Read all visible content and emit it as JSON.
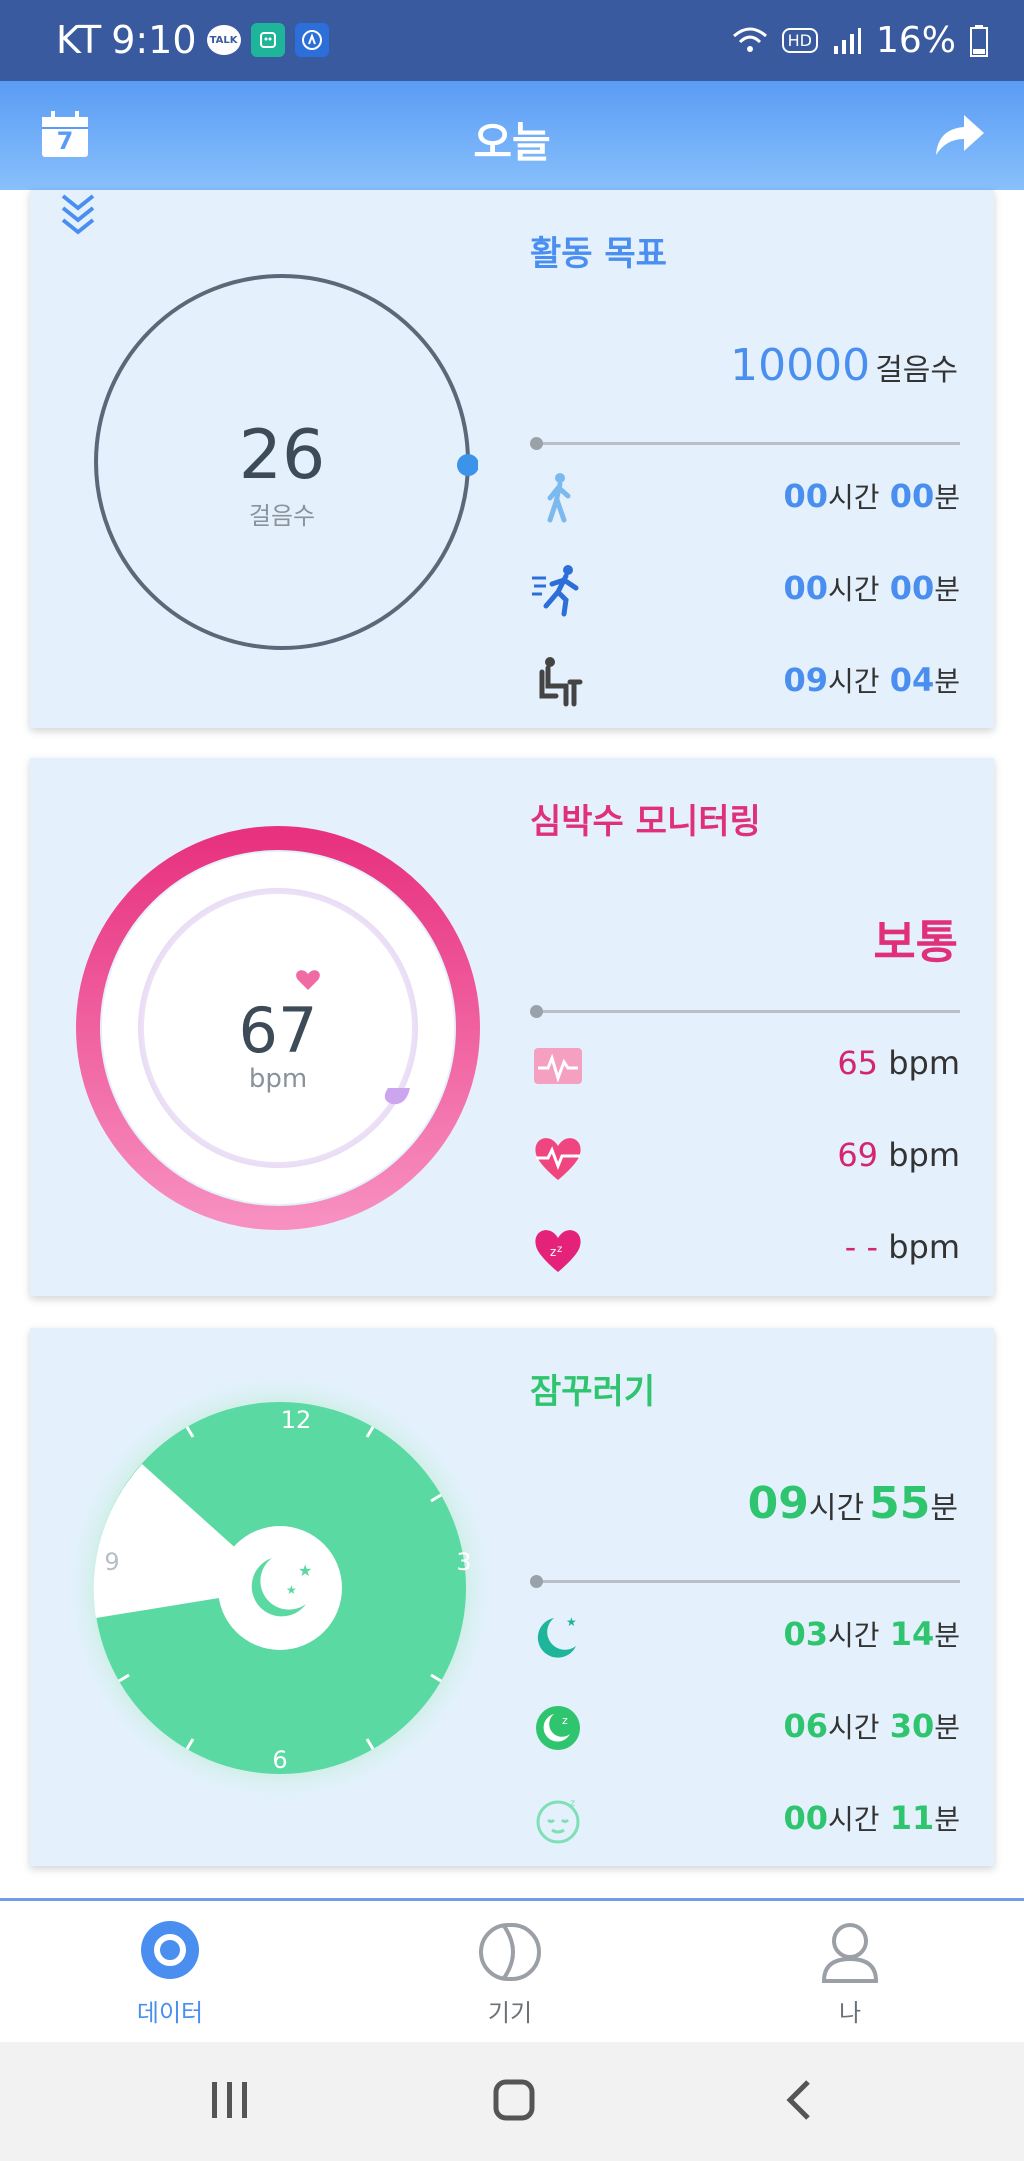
{
  "status_bar": {
    "carrier": "KT",
    "time": "9:10",
    "battery": "16%",
    "hd": "HD",
    "talk_label": "TALK",
    "app_icons": [
      "talk-icon",
      "mi-fit-icon",
      "activity-icon"
    ]
  },
  "app_bar": {
    "title": "오늘",
    "calendar_day": "7"
  },
  "activity": {
    "title": "활동 목표",
    "steps": "26",
    "steps_label": "걸음수",
    "goal_value": "10000",
    "goal_unit": "걸음수",
    "progress": 0.0026,
    "rows": [
      {
        "icon": "walking-icon",
        "h": "00",
        "m": "00"
      },
      {
        "icon": "running-icon",
        "h": "00",
        "m": "00"
      },
      {
        "icon": "sitting-icon",
        "h": "09",
        "m": "04"
      }
    ],
    "hour_unit": "시간",
    "min_unit": "분"
  },
  "heart": {
    "title": "심박수 모니터링",
    "bpm": "67",
    "bpm_label": "bpm",
    "status": "보통",
    "rows": [
      {
        "icon": "heart-wave-icon",
        "value": "65",
        "unit": "bpm"
      },
      {
        "icon": "heart-pulse-icon",
        "value": "69",
        "unit": "bpm"
      },
      {
        "icon": "heart-sleep-icon",
        "value": "- -",
        "unit": "bpm"
      }
    ]
  },
  "sleep": {
    "title": "잠꾸러기",
    "total_h": "09",
    "total_m": "55",
    "clock": {
      "n12": "12",
      "n3": "3",
      "n6": "6",
      "n9": "9"
    },
    "rows": [
      {
        "icon": "moon-stars-icon",
        "h": "03",
        "m": "14"
      },
      {
        "icon": "moon-zz-icon",
        "h": "06",
        "m": "30"
      },
      {
        "icon": "sleepy-face-icon",
        "h": "00",
        "m": "11"
      }
    ],
    "hour_unit": "시간",
    "min_unit": "분"
  },
  "nav": {
    "items": [
      {
        "label": "데이터"
      },
      {
        "label": "기기"
      },
      {
        "label": "나"
      }
    ]
  },
  "colors": {
    "accent": "#4a8ff0",
    "heart": "#e0307a",
    "sleep": "#2fc46e",
    "card_bg": "#e4f1fd"
  }
}
